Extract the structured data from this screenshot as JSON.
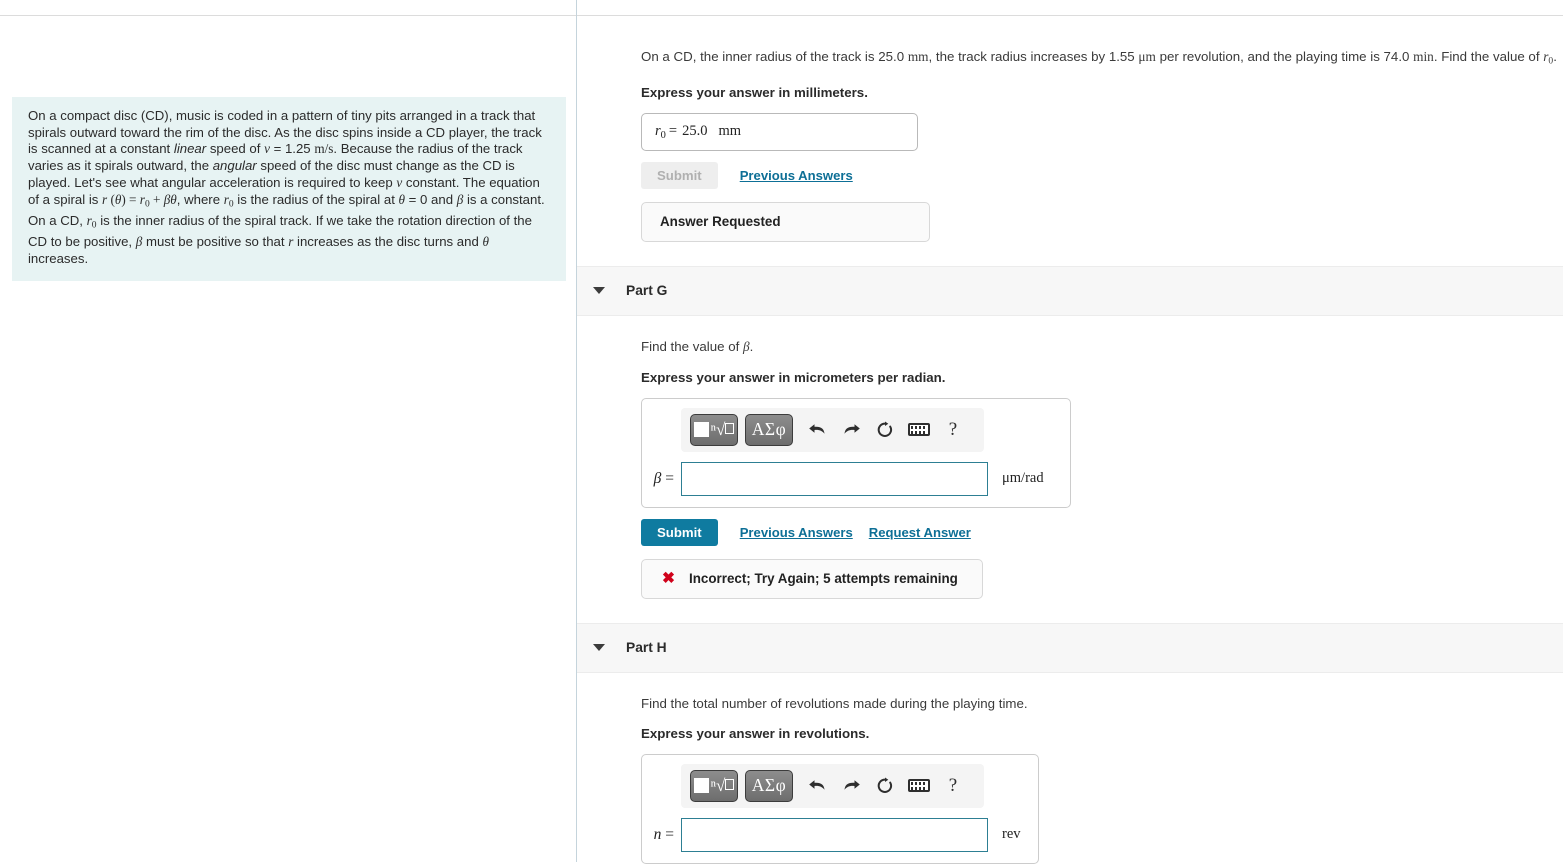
{
  "intro": {
    "paragraph_parts": [
      "On a compact disc (CD), music is coded in a pattern of tiny pits arranged in a track that spirals outward toward the rim of the disc. As the disc spins inside a CD player, the track is scanned at a constant ",
      "linear",
      " speed of ",
      "v",
      " = 1.25 ",
      "m/s",
      ". Because the radius of the track varies as it spirals outward, the ",
      "angular",
      " speed of the disc must change as the CD is played. Let's see what angular acceleration is required to keep ",
      "v",
      " constant. The equation of a spiral is ",
      "r (θ) = r0 + βθ",
      ", where ",
      "r0",
      " is the radius of the spiral at ",
      "θ",
      " = 0 and ",
      "β",
      " is a constant. On a CD, ",
      "r0",
      " is the inner radius of the spiral track. If we take the rotation direction of the CD to be positive, ",
      "β",
      " must be positive so that ",
      "r",
      " increases as the disc turns and ",
      "θ",
      " increases."
    ]
  },
  "top_question": {
    "text_1": "On a CD, the inner radius of the track is 25.0 ",
    "unit_mm": "mm",
    "text_2": ", the track radius increases by 1.55 ",
    "unit_um": "μm",
    "text_3": " per revolution, and the playing time is 74.0 ",
    "unit_min": "min",
    "text_4": ". Find the value of ",
    "var_r0": "r",
    "var_r0_sub": "0",
    "text_5": ".",
    "express": "Express your answer in millimeters.",
    "answer": {
      "label": "r",
      "label_sub": "0",
      "equals": "=",
      "value": "25.0",
      "unit": "mm"
    },
    "submit_label": "Submit",
    "previous_answers_label": "Previous Answers",
    "status": "Answer Requested"
  },
  "part_g": {
    "title": "Part G",
    "prompt_prefix": "Find the value of ",
    "prompt_var": "β",
    "prompt_suffix": ".",
    "express": "Express your answer in micrometers per radian.",
    "var_label": "β",
    "var_equals": "=",
    "input_value": "",
    "unit": "μm/rad",
    "submit_label": "Submit",
    "previous_answers_label": "Previous Answers",
    "request_answer_label": "Request Answer",
    "status_icon": "✖",
    "status": "Incorrect; Try Again; 5 attempts remaining"
  },
  "part_h": {
    "title": "Part H",
    "prompt": "Find the total number of revolutions made during the playing time.",
    "express": "Express your answer in revolutions.",
    "var_label": "n",
    "var_equals": "=",
    "input_value": "",
    "unit": "rev"
  },
  "toolbar": {
    "template_button": "□ⁿ√□",
    "greek_button": "ΑΣφ",
    "undo": "↰",
    "redo": "↱",
    "reset": "↺",
    "keyboard": "keyboard",
    "help": "?"
  },
  "colors": {
    "accent_teal": "#0f7ba0",
    "link_teal": "#0d6f96",
    "intro_bg": "#e7f3f3",
    "error_red": "#d0021b",
    "band_bg": "#f7f7f7",
    "input_border": "#2d7f93"
  }
}
